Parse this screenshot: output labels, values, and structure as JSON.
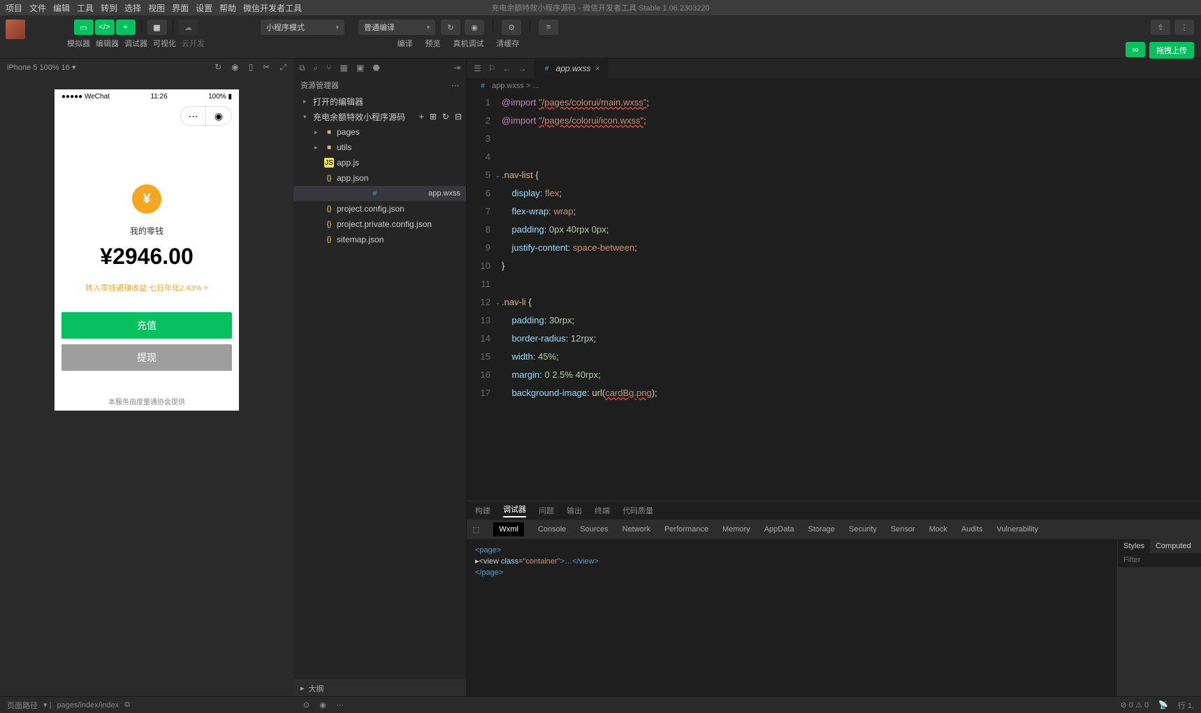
{
  "menubar": [
    "项目",
    "文件",
    "编辑",
    "工具",
    "转到",
    "选择",
    "视图",
    "界面",
    "设置",
    "帮助",
    "微信开发者工具"
  ],
  "title": "充电余额特效小程序源码 - 微信开发者工具 Stable 1.06.2303220",
  "toolbar": {
    "labels": [
      "模拟器",
      "编辑器",
      "调试器",
      "可视化",
      "云开发"
    ],
    "mode_select": "小程序模式",
    "compile_select": "普通编译",
    "compile_labels": [
      "编译",
      "预览",
      "真机调试",
      "清缓存"
    ],
    "upload": "拖拽上传"
  },
  "simulator": {
    "device": "iPhone 5 100% 16",
    "status_carrier": "●●●●● WeChat",
    "status_time": "11:26",
    "status_battery": "100%",
    "balance_label": "我的零钱",
    "balance_amount": "¥2946.00",
    "balance_link": "转入零钱通赚收益 七日年化2.43% >",
    "btn_deposit": "充值",
    "btn_withdraw": "提现",
    "footer": "本服务由度量通协会提供"
  },
  "explorer": {
    "title": "资源管理器",
    "section_open": "打开的编辑器",
    "project": "充电余额特效小程序源码",
    "files": [
      {
        "name": "pages",
        "type": "folder",
        "level": 2
      },
      {
        "name": "utils",
        "type": "folder",
        "level": 2
      },
      {
        "name": "app.js",
        "type": "js",
        "level": 2
      },
      {
        "name": "app.json",
        "type": "json",
        "level": 2
      },
      {
        "name": "app.wxss",
        "type": "wxss",
        "level": 2,
        "selected": true
      },
      {
        "name": "project.config.json",
        "type": "json",
        "level": 2
      },
      {
        "name": "project.private.config.json",
        "type": "json",
        "level": 2
      },
      {
        "name": "sitemap.json",
        "type": "json",
        "level": 2
      }
    ],
    "outline": "大纲"
  },
  "editor": {
    "tab": "app.wxss",
    "breadcrumb": "app.wxss > ...",
    "lines": [
      {
        "n": 1,
        "html": "<span class='c-kw'>@import</span> <span class='c-err'>\"/pages/colorui/main.wxss\"</span><span class='c-punc'>;</span>"
      },
      {
        "n": 2,
        "html": "<span class='c-kw'>@import</span> <span class='c-err'>\"/pages/colorui/icon.wxss\"</span><span class='c-punc'>;</span>"
      },
      {
        "n": 3,
        "html": ""
      },
      {
        "n": 4,
        "html": ""
      },
      {
        "n": 5,
        "html": "<span class='c-sel'>.nav-list</span> <span class='c-punc'>{</span>",
        "fold": true
      },
      {
        "n": 6,
        "html": "    <span class='c-prop'>display</span><span class='c-punc'>:</span> <span class='c-val'>flex</span><span class='c-punc'>;</span>"
      },
      {
        "n": 7,
        "html": "    <span class='c-prop'>flex-wrap</span><span class='c-punc'>:</span> <span class='c-val'>wrap</span><span class='c-punc'>;</span>"
      },
      {
        "n": 8,
        "html": "    <span class='c-prop'>padding</span><span class='c-punc'>:</span> <span class='c-num'>0px</span> <span class='c-num'>40rpx</span> <span class='c-num'>0px</span><span class='c-punc'>;</span>"
      },
      {
        "n": 9,
        "html": "    <span class='c-prop'>justify-content</span><span class='c-punc'>:</span> <span class='c-val'>space-between</span><span class='c-punc'>;</span>"
      },
      {
        "n": 10,
        "html": "<span class='c-punc'>}</span>"
      },
      {
        "n": 11,
        "html": ""
      },
      {
        "n": 12,
        "html": "<span class='c-sel'>.nav-li</span> <span class='c-punc'>{</span>",
        "fold": true
      },
      {
        "n": 13,
        "html": "    <span class='c-prop'>padding</span><span class='c-punc'>:</span> <span class='c-num'>30rpx</span><span class='c-punc'>;</span>"
      },
      {
        "n": 14,
        "html": "    <span class='c-prop'>border-radius</span><span class='c-punc'>:</span> <span class='c-num'>12rpx</span><span class='c-punc'>;</span>"
      },
      {
        "n": 15,
        "html": "    <span class='c-prop'>width</span><span class='c-punc'>:</span> <span class='c-num'>45%</span><span class='c-punc'>;</span>"
      },
      {
        "n": 16,
        "html": "    <span class='c-prop'>margin</span><span class='c-punc'>:</span> <span class='c-num'>0</span> <span class='c-num'>2.5%</span> <span class='c-num'>40rpx</span><span class='c-punc'>;</span>"
      },
      {
        "n": 17,
        "html": "    <span class='c-prop'>background-image</span><span class='c-punc'>:</span> <span class='c-fn'>url</span><span class='c-punc'>(</span><span class='c-err'>cardBg.png</span><span class='c-punc'>);</span>"
      }
    ]
  },
  "debug": {
    "top_tabs": [
      "构建",
      "调试器",
      "问题",
      "输出",
      "终端",
      "代码质量"
    ],
    "top_active": "调试器",
    "dev_tabs": [
      "Wxml",
      "Console",
      "Sources",
      "Network",
      "Performance",
      "Memory",
      "AppData",
      "Storage",
      "Security",
      "Sensor",
      "Mock",
      "Audits",
      "Vulnerability"
    ],
    "dev_active": "Wxml",
    "styles_tabs": [
      "Styles",
      "Computed"
    ],
    "styles_active": "Styles",
    "filter_placeholder": "Filter",
    "wxml": {
      "l1": "<page>",
      "l2_open": "▸<view ",
      "l2_attr": "class",
      "l2_val": "\"container\"",
      "l2_mid": ">…</view>",
      "l3": "</page>"
    }
  },
  "statusbar": {
    "path_label": "页面路径",
    "path": "pages/index/index",
    "line": "行 1,"
  }
}
